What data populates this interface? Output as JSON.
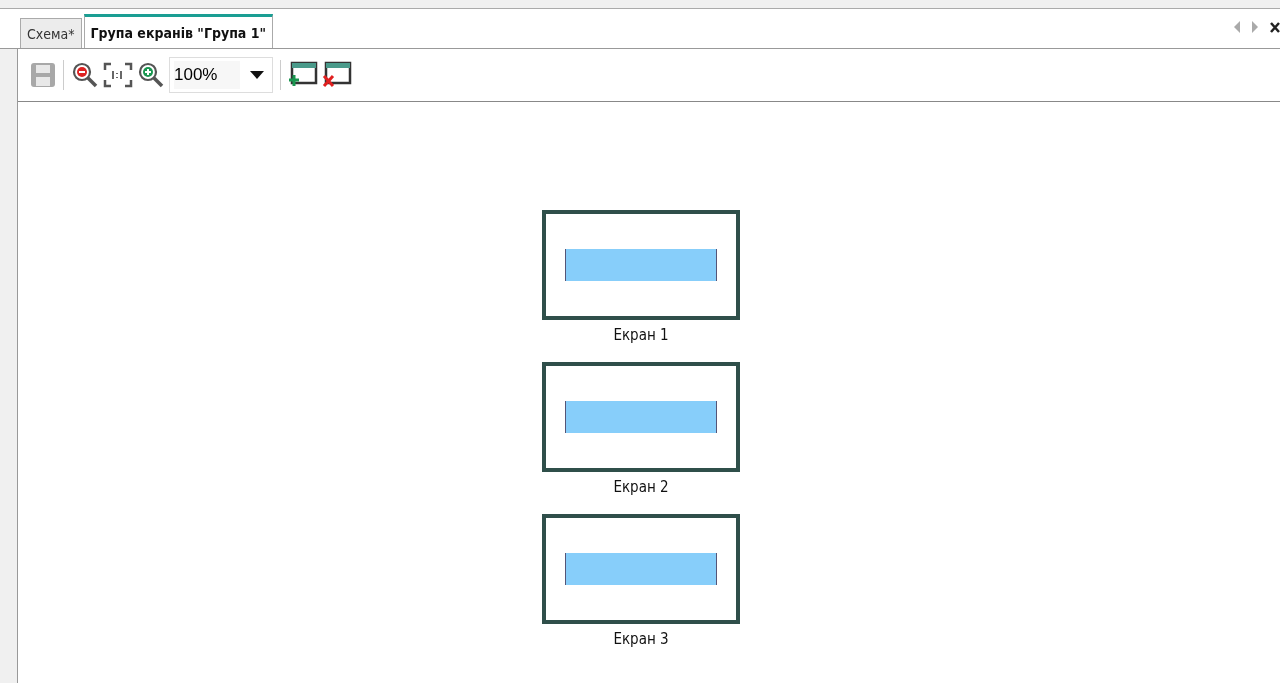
{
  "tabs": [
    {
      "label": "Схема*",
      "selected": false
    },
    {
      "label": "Група екранів \"Група 1\"",
      "selected": true
    }
  ],
  "toolbar": {
    "save_disabled": true,
    "zoom": {
      "value": "100%"
    }
  },
  "screens": [
    {
      "caption": "Екран 1"
    },
    {
      "caption": "Екран 2"
    },
    {
      "caption": "Екран 3"
    }
  ]
}
